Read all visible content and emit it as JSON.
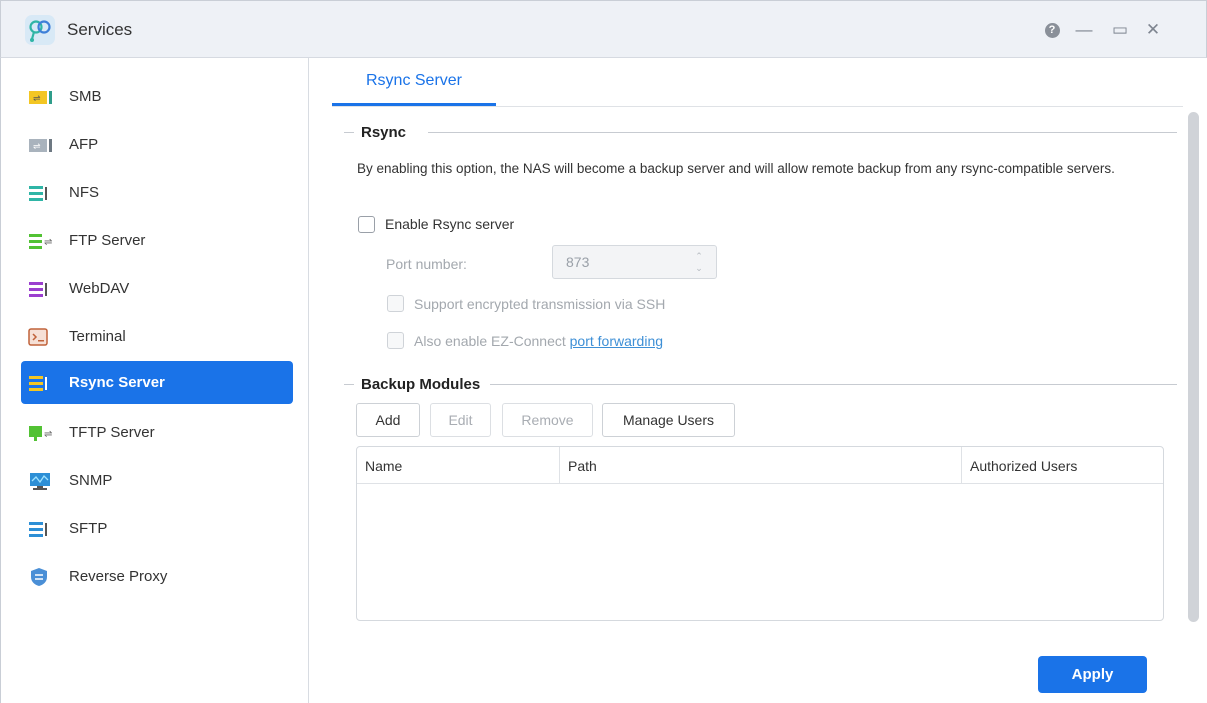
{
  "window": {
    "title": "Services",
    "logo_icon": "services-app-icon",
    "controls": [
      "help-icon",
      "minimize-icon",
      "maximize-icon",
      "close-icon"
    ],
    "help_glyph": "?",
    "min_glyph": "—",
    "max_glyph": "▭",
    "close_glyph": "✕"
  },
  "sidebar": {
    "items": [
      {
        "label": "SMB",
        "icon": "smb-icon"
      },
      {
        "label": "AFP",
        "icon": "afp-icon"
      },
      {
        "label": "NFS",
        "icon": "nfs-icon"
      },
      {
        "label": "FTP Server",
        "icon": "ftp-icon"
      },
      {
        "label": "WebDAV",
        "icon": "webdav-icon"
      },
      {
        "label": "Terminal",
        "icon": "terminal-icon"
      },
      {
        "label": "Rsync Server",
        "icon": "rsync-icon",
        "active": true
      },
      {
        "label": "TFTP Server",
        "icon": "tftp-icon"
      },
      {
        "label": "SNMP",
        "icon": "snmp-icon"
      },
      {
        "label": "SFTP",
        "icon": "sftp-icon"
      },
      {
        "label": "Reverse Proxy",
        "icon": "shield-icon"
      }
    ]
  },
  "main": {
    "tab": "Rsync Server",
    "rsync": {
      "section_title": "Rsync",
      "description": "By enabling this option, the NAS will become a backup server and will allow remote backup from any rsync-compatible servers.",
      "enable_label": "Enable Rsync server",
      "enable_checked": false,
      "port_label": "Port number:",
      "port_value": "873",
      "ssh_label": "Support encrypted transmission via SSH",
      "ezconnect_label": "Also enable EZ-Connect ",
      "ezconnect_link": "port forwarding"
    },
    "backup": {
      "section_title": "Backup Modules",
      "buttons": {
        "add": "Add",
        "edit": "Edit",
        "remove": "Remove",
        "manage_users": "Manage Users"
      },
      "columns": [
        "Name",
        "Path",
        "Authorized Users"
      ],
      "rows": []
    },
    "apply_label": "Apply"
  },
  "colors": {
    "accent": "#1a73e8",
    "link": "#3d8fd6"
  }
}
